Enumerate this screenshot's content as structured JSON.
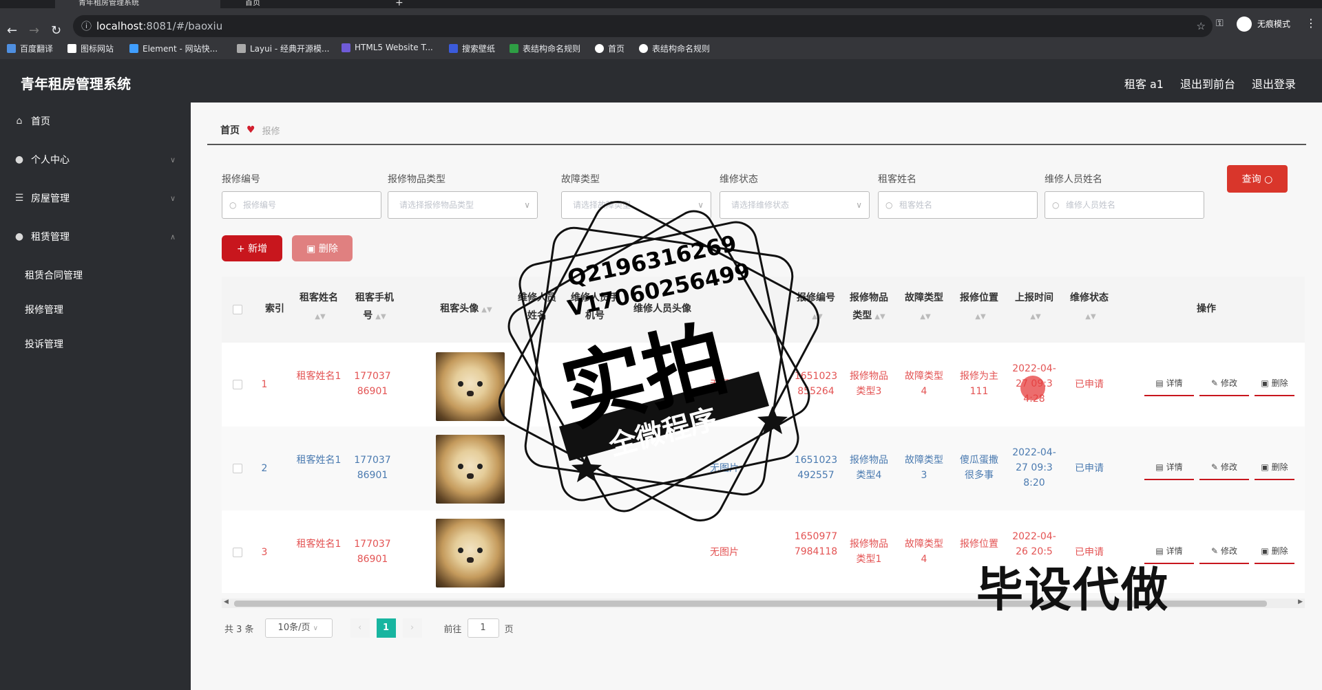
{
  "browser": {
    "tabs": [
      {
        "title": "青年租房管理系统"
      },
      {
        "title": "首页"
      }
    ],
    "url_host": "localhost",
    "url_path": ":8081/#/baoxiu",
    "profile": "无痕模式",
    "bookmarks": [
      "百度翻译",
      "图标网站",
      "Element - 网站快...",
      "Layui - 经典开源模...",
      "HTML5 Website T...",
      "搜索壁纸",
      "表结构命名规则",
      "首页",
      "表结构命名规则"
    ]
  },
  "header": {
    "title": "青年租房管理系统",
    "links": [
      "租客 a1",
      "退出到前台",
      "退出登录"
    ]
  },
  "sidebar": {
    "items": [
      {
        "label": "首页",
        "icon": "home-icon"
      },
      {
        "label": "个人中心",
        "icon": "user-icon"
      },
      {
        "label": "房屋管理",
        "icon": "list-icon"
      },
      {
        "label": "租赁管理",
        "icon": "bulb-icon"
      }
    ],
    "sub_items": [
      "租赁合同管理",
      "报修管理",
      "投诉管理"
    ]
  },
  "breadcrumb": {
    "home": "首页",
    "current": "报修"
  },
  "filters": [
    {
      "label": "报修编号",
      "placeholder": "报修编号"
    },
    {
      "label": "报修物品类型",
      "placeholder": "请选择报修物品类型"
    },
    {
      "label": "故障类型",
      "placeholder": "请选择故障类型"
    },
    {
      "label": "维修状态",
      "placeholder": "请选择维修状态"
    },
    {
      "label": "租客姓名",
      "placeholder": "租客姓名"
    },
    {
      "label": "维修人员姓名",
      "placeholder": "维修人员姓名"
    }
  ],
  "buttons": {
    "query": "查询",
    "add": "新增",
    "delete": "删除"
  },
  "table": {
    "columns": [
      "索引",
      "租客姓名",
      "租客手机号",
      "租客头像",
      "维修人员姓名",
      "维修人员手机号",
      "维修人员头像",
      "报修编号",
      "报修物品类型",
      "故障类型",
      "报修位置",
      "上报时间",
      "维修状态",
      "操作"
    ],
    "rows": [
      {
        "index": "1",
        "tenant": "租客姓名1",
        "phone": "17703786901",
        "repairer_avatar": "无图片",
        "code": "1651023855264",
        "item_type": "报修物品类型3",
        "fault": "故障类型4",
        "location": "报修为主111",
        "time": "2022-04-27 09:34:28",
        "status": "已申请"
      },
      {
        "index": "2",
        "tenant": "租客姓名1",
        "phone": "17703786901",
        "repairer_avatar": "无图片",
        "code": "1651023492557",
        "item_type": "报修物品类型4",
        "fault": "故障类型3",
        "location": "傻瓜蛋撒很多事",
        "time": "2022-04-27 09:38:20",
        "status": "已申请"
      },
      {
        "index": "3",
        "tenant": "租客姓名1",
        "phone": "17703786901",
        "repairer_avatar": "无图片",
        "code": "16509777984118",
        "item_type": "报修物品类型1",
        "fault": "故障类型4",
        "location": "报修位置",
        "time": "2022-04-26 20:5",
        "status": "已申请"
      }
    ],
    "actions": [
      "详情",
      "修改",
      "删除"
    ]
  },
  "pagination": {
    "total": "共 3 条",
    "page_size": "10条/页",
    "current": "1",
    "goto_label": "前往",
    "goto_value": "1",
    "page_unit": "页"
  },
  "overlay": {
    "qq": "Q2196316269",
    "v": "V17060256499",
    "big": "实拍",
    "banner": "全微程序",
    "corner": "毕设代做"
  },
  "colors": {
    "primary_red": "#c8161d",
    "teal": "#18b5a0",
    "dark_bg": "#2b2d31"
  }
}
